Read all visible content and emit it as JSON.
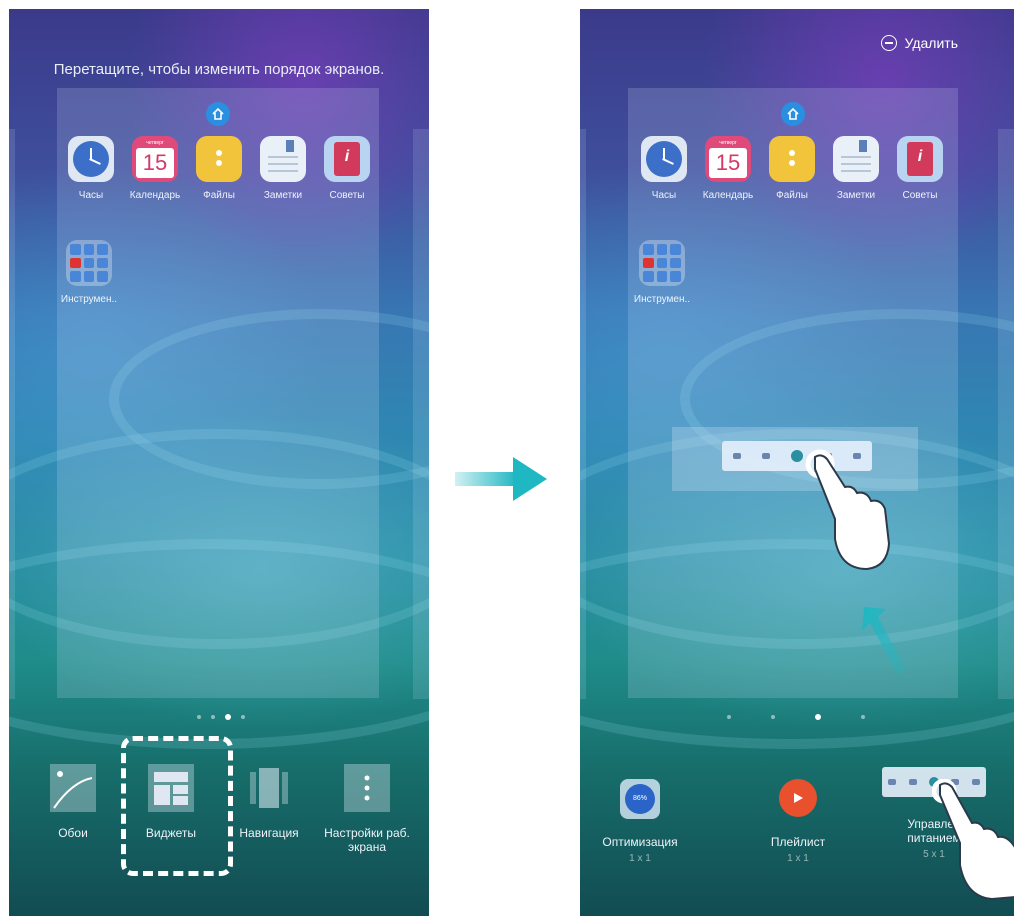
{
  "left_screen": {
    "hint": "Перетащите, чтобы изменить порядок экранов.",
    "apps": [
      {
        "label": "Часы"
      },
      {
        "label": "Календарь",
        "day_label": "четверг",
        "date": "15"
      },
      {
        "label": "Файлы"
      },
      {
        "label": "Заметки"
      },
      {
        "label": "Советы"
      }
    ],
    "folder": {
      "label": "Инструмен.."
    },
    "page_dots": {
      "count": 4,
      "active": 3
    },
    "options": [
      {
        "label": "Обои",
        "icon": "wallpaper-icon"
      },
      {
        "label": "Виджеты",
        "icon": "widgets-icon",
        "selected": true
      },
      {
        "label": "Навигация",
        "icon": "navigation-icon"
      },
      {
        "label": "Настройки раб. экрана",
        "icon": "settings-icon"
      }
    ]
  },
  "right_screen": {
    "delete_label": "Удалить",
    "apps": [
      {
        "label": "Часы"
      },
      {
        "label": "Календарь",
        "day_label": "четверг",
        "date": "15"
      },
      {
        "label": "Файлы"
      },
      {
        "label": "Заметки"
      },
      {
        "label": "Советы"
      }
    ],
    "folder": {
      "label": "Инструмен.."
    },
    "page_dots": {
      "count": 4,
      "active": 3
    },
    "widgets": [
      {
        "name": "Оптимизация",
        "size": "1 x 1",
        "icon_text": "86%"
      },
      {
        "name": "Плейлист",
        "size": "1 x 1"
      },
      {
        "name": "Управление питанием",
        "name_shown": "Управлен\nпитанием",
        "size": "5 x 1"
      }
    ]
  },
  "colors": {
    "accent_arrow": "#1fb7c2",
    "calendar": "#e04a7a",
    "files": "#f2c43c",
    "playlist": "#e8502e"
  }
}
